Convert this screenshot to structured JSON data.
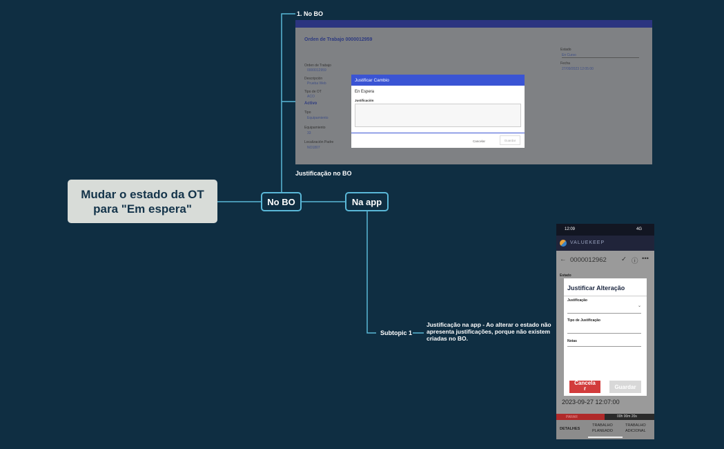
{
  "mindmap": {
    "root": "Mudar o estado da OT\npara \"Em espera\"",
    "node_bo": "No BO",
    "node_app": "Na app",
    "child_no_bo": "1. No BO",
    "caption_bo": "Justificação no BO",
    "subtopic": "Subtopic 1",
    "subtopic_note": "Justificação na app - Ao alterar o estado não apresenta justificações, porque não existem criadas no BO."
  },
  "bo_screenshot": {
    "title": "Orden de Trabajo 0000012959",
    "estado_label": "Estado",
    "estado_value": "En Curso",
    "fecha_label": "Fecha",
    "fecha_value": "27/09/2023 12:05:00",
    "orden_label": "Orden de Trabajo",
    "orden_value": "0000012959",
    "descripcion_label": "Descripción",
    "descripcion_value": "Prueba Web",
    "tipo_ot_label": "Tipo de OT",
    "tipo_ot_value": "ACO",
    "activo_heading": "Activo",
    "tipo_label": "Tipo",
    "tipo_value": "Equipamiento",
    "equipamiento_label": "Equipamiento",
    "equipamiento_value": "33",
    "localizacion_label": "Localización Padre",
    "localizacion_value": "NO1807",
    "dialog": {
      "title": "Justificar Cambio",
      "state": "En Espera",
      "field_label": "Justificación",
      "cancel": "Cancelar",
      "save": "Guardar"
    }
  },
  "app_screenshot": {
    "clock": "12:09",
    "signal": "4G",
    "brand": "VALUEKEEP",
    "ot_number": "0000012962",
    "estado_label": "Estado",
    "modal_title": "Justificar Alteração",
    "justificacao_label": "Justificação",
    "tipo_label": "Tipo de Justificação",
    "notas_label": "Notas",
    "cancel": "Cancela\nr",
    "save": "Guardar",
    "date": "2023-09-27 12:07:00",
    "stop": "PARAR",
    "timer": "00h 00m 20s",
    "tab_detalhes": "DETALHES",
    "tab_planeado": "TRABALHO\nPLANEADO",
    "tab_adicional": "TRABALHO\nADICIONAL"
  },
  "colors": {
    "background": "#0f2e42",
    "connector": "#5ab8d8",
    "root_fill": "#d8dcd8"
  }
}
